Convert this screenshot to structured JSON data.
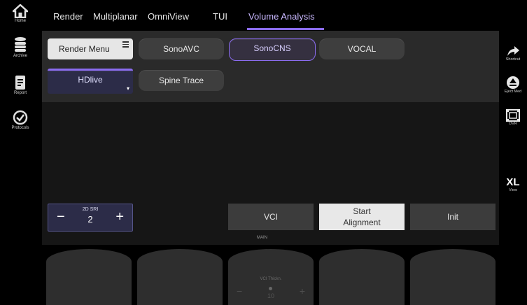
{
  "left_rail": [
    {
      "label": "Home",
      "icon": "home-icon"
    },
    {
      "label": "Archive",
      "icon": "database-icon"
    },
    {
      "label": "Report",
      "icon": "report-icon"
    },
    {
      "label": "Protocols",
      "icon": "check-circle-icon"
    }
  ],
  "tabs": [
    {
      "label": "Render"
    },
    {
      "label": "Multiplanar"
    },
    {
      "label": "OmniView"
    },
    {
      "label": "TUI"
    },
    {
      "label": "Volume Analysis"
    }
  ],
  "buttons": {
    "render_menu": "Render Menu",
    "sonoavc": "SonoAVC",
    "sonocns": "SonoCNS",
    "vocal": "VOCAL",
    "hdlive": "HDlive",
    "spine_trace": "Spine Trace"
  },
  "sri": {
    "title": "2D SRI",
    "value": "2",
    "minus": "−",
    "plus": "+"
  },
  "actions": {
    "vci": "VCI",
    "start_alignment_line1": "Start",
    "start_alignment_line2": "Alignment",
    "init": "Init"
  },
  "main_tag": "MAIN",
  "right_rail": [
    {
      "label": "Shortcut",
      "icon": "arrow-icon"
    },
    {
      "label": "Eject Med",
      "icon": "eject-icon"
    },
    {
      "label": "DVR",
      "icon": "dvr-icon"
    },
    {
      "label": "View",
      "icon_text": "XL"
    }
  ],
  "knob": {
    "label": "VCI Thickn.",
    "value": "10"
  },
  "colors": {
    "accent": "#8b6cf0",
    "background": "#000000",
    "panel": "#2a2a2a"
  }
}
